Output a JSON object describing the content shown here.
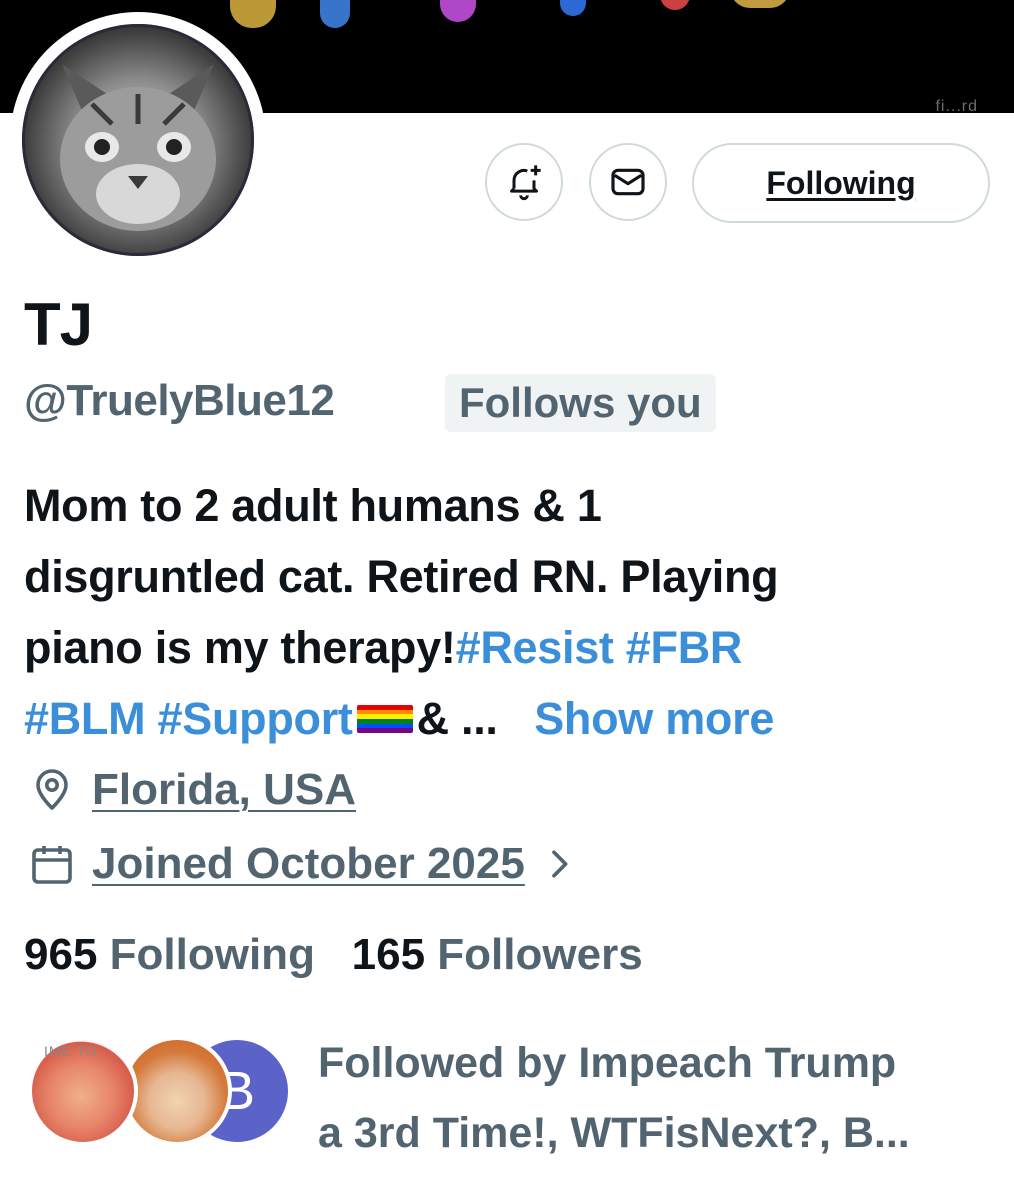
{
  "banner": {
    "caption": "fi...rd"
  },
  "actions": {
    "notify_icon": "bell-plus-icon",
    "message_icon": "envelope-icon",
    "following_label": "Following"
  },
  "profile": {
    "name": "TJ",
    "handle": "@TruelyBlue12",
    "follows_you": "Follows you",
    "bio": {
      "line1": "Mom to 2 adult humans & 1",
      "line2": "disgruntled cat. Retired RN. Playing",
      "line3_text": "piano is my therapy!",
      "line3_tags": "#Resist #FBR",
      "line4_tags": "#BLM #Support",
      "line4_rest": "& ...",
      "show_more": "Show more"
    },
    "location": "Florida, USA",
    "joined": "Joined October 2025"
  },
  "stats": {
    "following_count": "965",
    "following_label": "Following",
    "followers_count": "165",
    "followers_label": "Followers"
  },
  "followed_by": {
    "avatar_a_label": "IME TO",
    "avatar_c_initial": "B",
    "line1": "Followed by Impeach Trump",
    "line2": "a 3rd Time!, WTFisNext?, B..."
  },
  "colors": {
    "link": "#3b8fd9",
    "secondary_text": "#536471",
    "primary_text": "#0f1419"
  }
}
